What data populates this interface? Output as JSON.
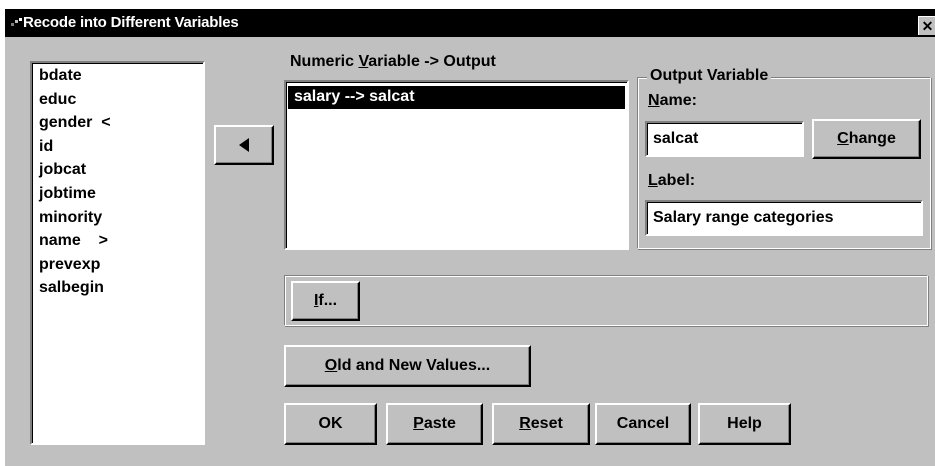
{
  "window": {
    "title": "Recode into Different Variables",
    "close_glyph": "✕"
  },
  "source_list": {
    "items": [
      {
        "label": "bdate"
      },
      {
        "label": "educ"
      },
      {
        "label": "gender  <"
      },
      {
        "label": "id"
      },
      {
        "label": "jobcat"
      },
      {
        "label": "jobtime"
      },
      {
        "label": "minority"
      },
      {
        "label": "name    >"
      },
      {
        "label": "prevexp"
      },
      {
        "label": "salbegin"
      }
    ]
  },
  "move_button": {
    "icon": "left-arrow-icon",
    "glyph": "◀"
  },
  "mapping": {
    "header_pre": "Numeric ",
    "header_mnemonic": "V",
    "header_post": "ariable -> Output",
    "items": [
      {
        "label": "salary --> salcat",
        "selected": true
      }
    ]
  },
  "output_variable": {
    "group_title": "Output Variable",
    "name_mnemonic": "N",
    "name_rest": "ame:",
    "name_value": "salcat",
    "change_mnemonic": "C",
    "change_rest": "hange",
    "label_mnemonic": "L",
    "label_rest": "abel:",
    "label_value": "Salary range categories"
  },
  "if_button": {
    "mnemonic": "I",
    "rest": "f..."
  },
  "old_new_button": {
    "mnemonic": "O",
    "rest": "ld and New Values..."
  },
  "buttons": {
    "ok": "OK",
    "paste_mnemonic": "P",
    "paste_rest": "aste",
    "reset_mnemonic": "R",
    "reset_rest": "eset",
    "cancel": "Cancel",
    "help": "Help"
  },
  "colors": {
    "face": "#c0c0c0",
    "selection": "#000000",
    "title_bar": "#000000"
  }
}
